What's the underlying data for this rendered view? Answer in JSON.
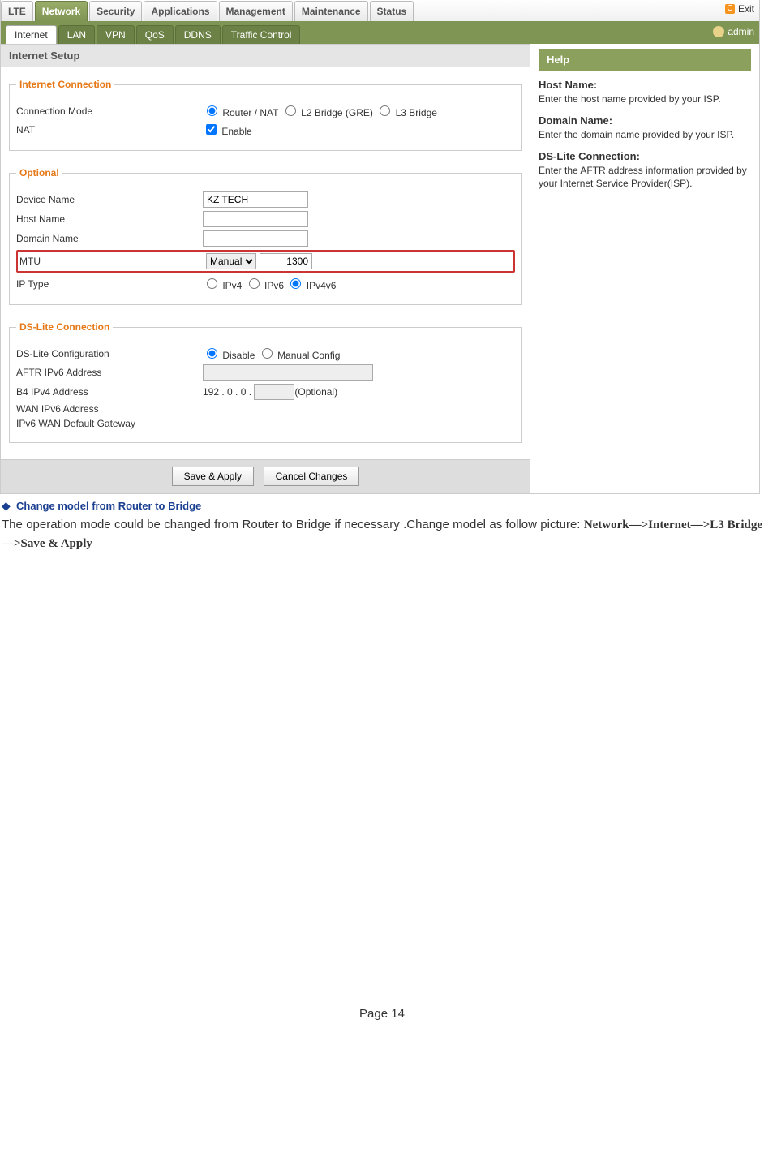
{
  "top": {
    "tabs": [
      "LTE",
      "Network",
      "Security",
      "Applications",
      "Management",
      "Maintenance",
      "Status"
    ],
    "activeIndex": 1,
    "exit": "Exit",
    "admin": "admin",
    "subtabs": [
      "Internet",
      "LAN",
      "VPN",
      "QoS",
      "DDNS",
      "Traffic Control"
    ],
    "subActive": 0
  },
  "panel": {
    "title": "Internet Setup",
    "helpTitle": "Help"
  },
  "conn": {
    "legend": "Internet Connection",
    "modeLabel": "Connection Mode",
    "opt1": "Router / NAT",
    "opt2": "L2 Bridge (GRE)",
    "opt3": "L3 Bridge",
    "natLabel": "NAT",
    "natEnable": "Enable"
  },
  "opt": {
    "legend": "Optional",
    "dev": "Device Name",
    "devVal": "KZ TECH",
    "host": "Host Name",
    "domain": "Domain Name",
    "mtu": "MTU",
    "mtuMode": "Manual",
    "mtuVal": "1300",
    "ipType": "IP Type",
    "ip4": "IPv4",
    "ip6": "IPv6",
    "ip46": "IPv4v6"
  },
  "dsl": {
    "legend": "DS-Lite Connection",
    "cfg": "DS-Lite Configuration",
    "disable": "Disable",
    "manual": "Manual Config",
    "aftr": "AFTR IPv6 Address",
    "b4": "B4 IPv4 Address",
    "b4pre": "192 . 0 . 0 .",
    "b4note": "(Optional)",
    "wan6": "WAN IPv6 Address",
    "gw": "IPv6 WAN Default Gateway"
  },
  "btns": {
    "save": "Save & Apply",
    "cancel": "Cancel Changes"
  },
  "help": {
    "h1": "Host Name:",
    "p1": "Enter the host name provided by your ISP.",
    "h2": "Domain Name:",
    "p2": "Enter the domain name provided by your ISP.",
    "h3": "DS-Lite Connection:",
    "p3": "Enter the AFTR address information provided by your Internet Service Provider(ISP)."
  },
  "doc": {
    "title": "Change model from Router to Bridge",
    "bodyA": "The operation mode could be changed from Router to Bridge if necessary .Change model as follow picture: ",
    "nav": "Network—>Internet—>L3 Bridge—>Save & Apply",
    "page": "Page 14"
  }
}
